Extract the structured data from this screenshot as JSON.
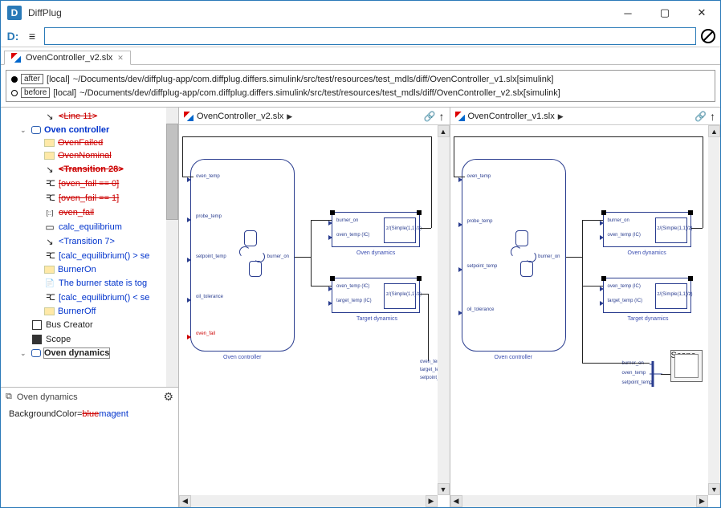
{
  "window": {
    "title": "DiffPlug"
  },
  "toolbar": {
    "search_value": ""
  },
  "tab": {
    "label": "OvenController_v2.slx"
  },
  "compare": {
    "after": {
      "tag": "after",
      "scope": "[local]",
      "path": "~/Documents/dev/diffplug-app/com.diffplug.differs.simulink/src/test/resources/test_mdls/diff/OvenController_v1.slx[simulink]"
    },
    "before": {
      "tag": "before",
      "scope": "[local]",
      "path": "~/Documents/dev/diffplug-app/com.diffplug.differs.simulink/src/test/resources/test_mdls/diff/OvenController_v2.slx[simulink]"
    }
  },
  "tree": {
    "items": [
      {
        "depth": 2,
        "icon": "trans",
        "label": "<Line 11>",
        "classes": "txt-red strike",
        "expander": ""
      },
      {
        "depth": 1,
        "icon": "sub",
        "label": "Oven controller",
        "classes": "txt-blue bold",
        "expander": "v"
      },
      {
        "depth": 2,
        "icon": "folder",
        "label": "OvenFailed",
        "classes": "txt-red strike",
        "expander": ""
      },
      {
        "depth": 2,
        "icon": "folder",
        "label": "OvenNominal",
        "classes": "txt-red strike",
        "expander": ""
      },
      {
        "depth": 2,
        "icon": "trans",
        "label": "<Transition 28>",
        "classes": "txt-red strike bold",
        "expander": ""
      },
      {
        "depth": 2,
        "icon": "cond",
        "label": "[oven_fail == 0]",
        "classes": "txt-red strike",
        "expander": ""
      },
      {
        "depth": 2,
        "icon": "cond",
        "label": "[oven_fail == 1]",
        "classes": "txt-red strike",
        "expander": ""
      },
      {
        "depth": 2,
        "icon": "data",
        "label": "oven_fail",
        "classes": "txt-red strike",
        "expander": ""
      },
      {
        "depth": 2,
        "icon": "block",
        "label": "calc_equilibrium",
        "classes": "txt-blue",
        "expander": ""
      },
      {
        "depth": 2,
        "icon": "trans",
        "label": "<Transition 7>",
        "classes": "txt-blue",
        "expander": ""
      },
      {
        "depth": 2,
        "icon": "cond",
        "label": "[calc_equilibrium() > se",
        "classes": "txt-blue",
        "expander": ""
      },
      {
        "depth": 2,
        "icon": "folder",
        "label": "BurnerOn",
        "classes": "txt-blue",
        "expander": ""
      },
      {
        "depth": 2,
        "icon": "note",
        "label": "The burner state is tog",
        "classes": "txt-blue",
        "expander": ""
      },
      {
        "depth": 2,
        "icon": "cond",
        "label": "[calc_equilibrium() < se",
        "classes": "txt-blue",
        "expander": ""
      },
      {
        "depth": 2,
        "icon": "folder",
        "label": "BurnerOff",
        "classes": "txt-blue",
        "expander": ""
      },
      {
        "depth": 1,
        "icon": "bus",
        "label": "Bus Creator",
        "classes": "",
        "expander": ""
      },
      {
        "depth": 1,
        "icon": "scope",
        "label": "Scope",
        "classes": "",
        "expander": ""
      },
      {
        "depth": 1,
        "icon": "sub",
        "label": "Oven dynamics",
        "classes": "bold boxed",
        "expander": "v"
      }
    ]
  },
  "props": {
    "title": "Oven dynamics",
    "row": {
      "key": "BackgroundColor=",
      "old": "blue",
      "new": "magent"
    }
  },
  "left": {
    "title": "OvenController_v2.slx",
    "ports_in": [
      "oven_temp",
      "probe_temp",
      "setpoint_temp",
      "oil_tolerance",
      "oven_fail"
    ],
    "controller_label": "Oven controller",
    "controller_out": "burner_on",
    "dyn_label": "Oven dynamics",
    "dyn_in": [
      "burner_on",
      "oven_temp (IC)"
    ],
    "dyn_box": "z/(Simple(1,1)/z)",
    "target_label": "Target dynamics",
    "target_in": [
      "oven_temp (IC)",
      "target_temp (IC)"
    ],
    "target_box": "z/(Simple(1,1)/z)",
    "bus_labels": [
      "oven_temp",
      "target_temp",
      "setpoint_temp"
    ]
  },
  "right": {
    "title": "OvenController_v1.slx",
    "ports_in": [
      "oven_temp",
      "probe_temp",
      "setpoint_temp",
      "oil_tolerance"
    ],
    "controller_label": "Oven controller",
    "controller_out": "burner_on",
    "dyn_label": "Oven dynamics",
    "dyn_in": [
      "burner_on",
      "oven_temp (IC)"
    ],
    "dyn_box": "z/(Simple(1,1)/z)",
    "target_label": "Target dynamics",
    "target_in": [
      "oven_temp (IC)",
      "target_temp (IC)"
    ],
    "target_box": "z/(Simple(1,1)/z)",
    "scope_label": "Scope",
    "bus_labels": [
      "burner_on",
      "oven_temp",
      "setpoint_temp"
    ]
  }
}
